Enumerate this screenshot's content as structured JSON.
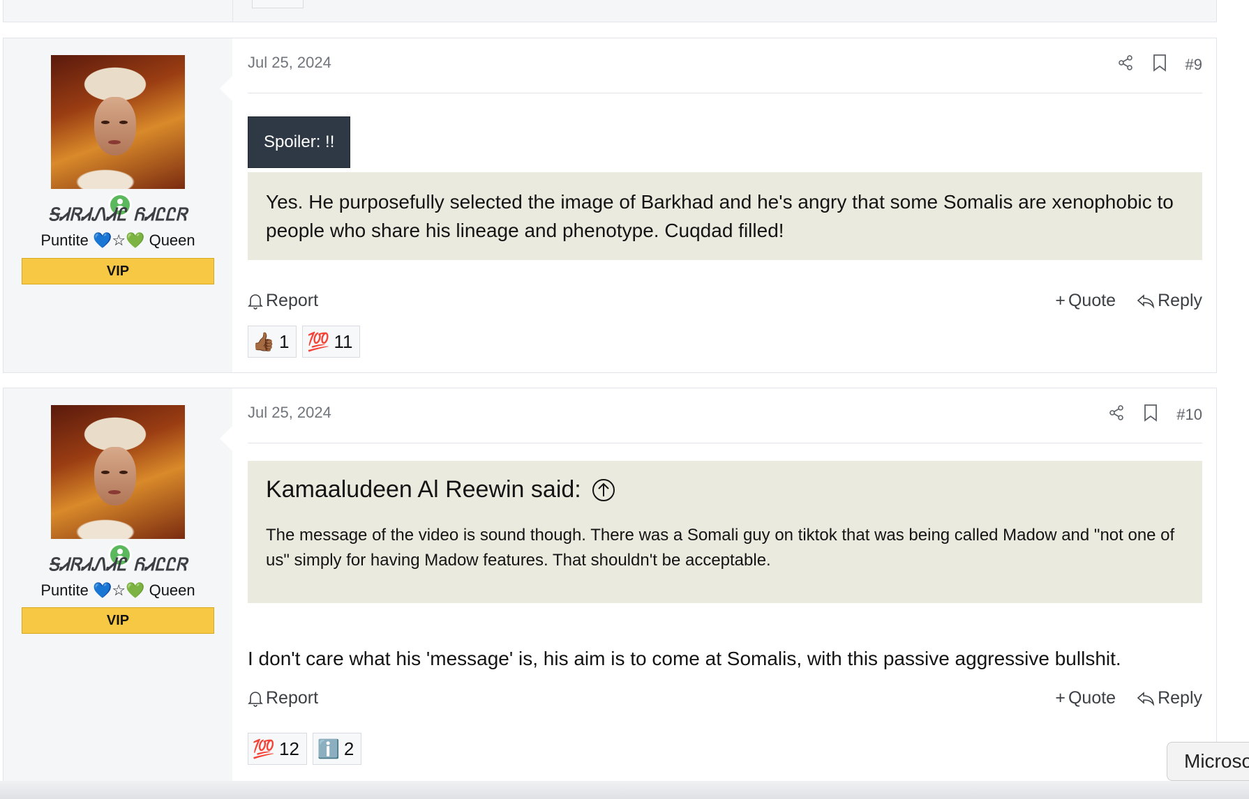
{
  "posts": [
    {
      "username": "ᎦᏗᏒᏗᏁᏗᏝ ᏲᏗᏝᏝᏒ",
      "user_title": "Puntite 💙☆💚 Queen",
      "badge": "VIP",
      "date": "Jul 25, 2024",
      "post_number": "#9",
      "spoiler_label": "Spoiler: !!",
      "spoiler_text": "Yes. He purposefully selected the image of Barkhad and he's angry that some Somalis are xenophobic to people who share his lineage and phenotype. Cuqdad filled!",
      "report_label": "Report",
      "quote_label": "Quote",
      "reply_label": "Reply",
      "reactions": [
        {
          "emoji": "👍🏾",
          "count": "1"
        },
        {
          "emoji": "💯",
          "count": "11"
        }
      ]
    },
    {
      "username": "ᎦᏗᏒᏗᏁᏗᏝ ᏲᏗᏝᏝᏒ",
      "user_title": "Puntite 💙☆💚 Queen",
      "badge": "VIP",
      "date": "Jul 25, 2024",
      "post_number": "#10",
      "quote_author": "Kamaaludeen Al Reewin said:",
      "quote_text": "The message of the video is sound though. There was a Somali guy on tiktok that was being called Madow and \"not one of us\" simply for having Madow features. That shouldn't be acceptable.",
      "body": "I don't care what his 'message' is, his aim is to come at Somalis, with this passive aggressive bullshit.",
      "report_label": "Report",
      "quote_label": "Quote",
      "reply_label": "Reply",
      "reactions": [
        {
          "emoji": "💯",
          "count": "12"
        },
        {
          "emoji": "ℹ️",
          "count": "2"
        }
      ]
    }
  ],
  "toast": {
    "text": "Microso"
  },
  "colors": {
    "vip": "#f7c843",
    "online": "#5cb85c",
    "spoiler_bg": "#2f3945",
    "quote_bg": "#ebeadf"
  }
}
